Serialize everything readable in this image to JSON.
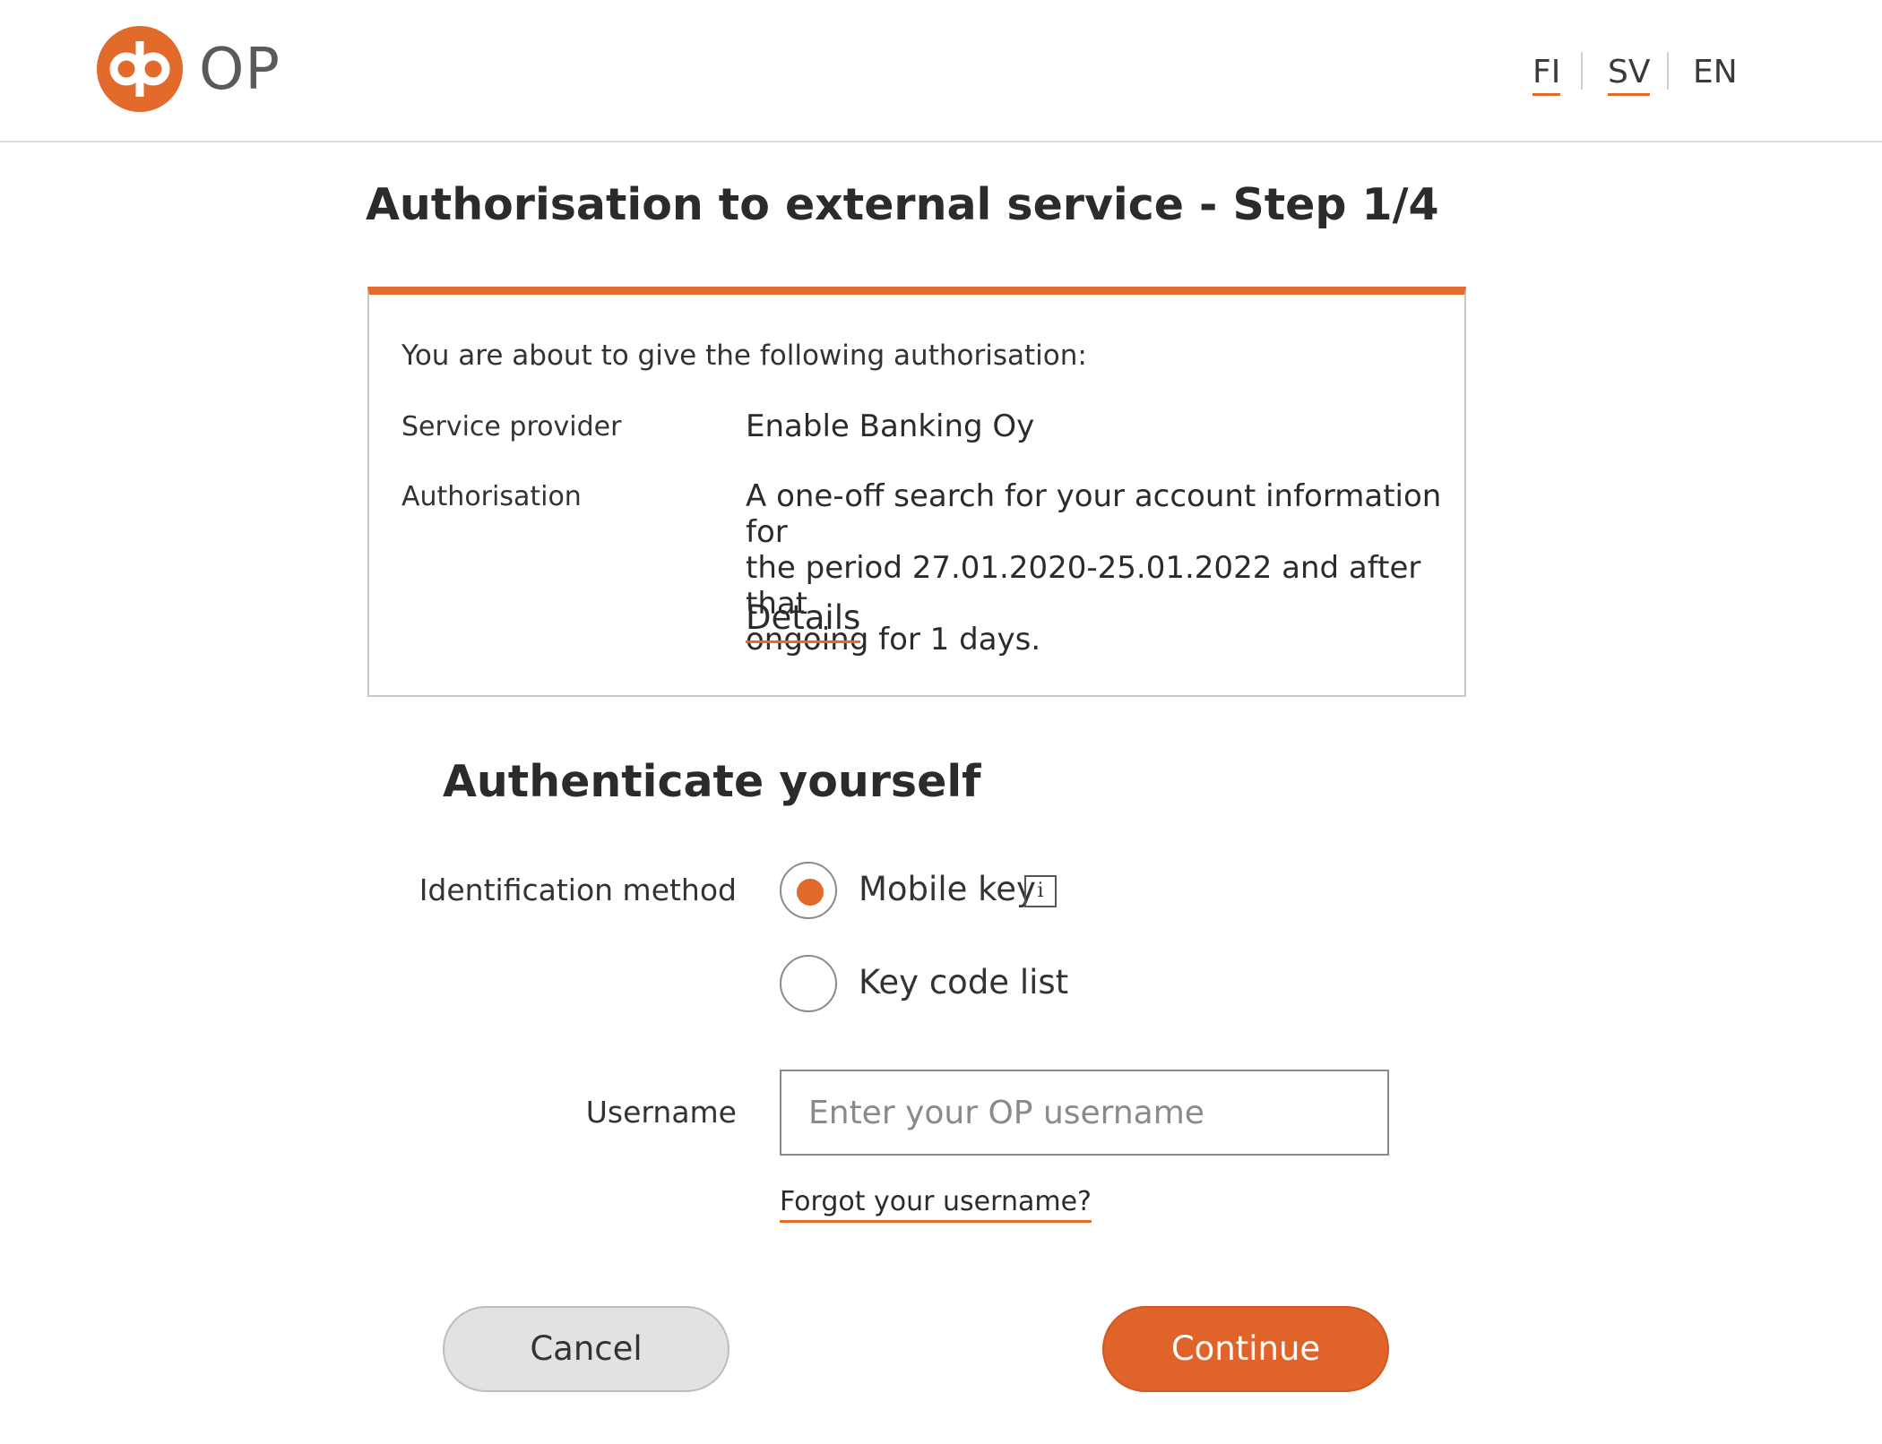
{
  "header": {
    "logo_text": "OP",
    "languages": [
      {
        "code": "FI",
        "linked": true
      },
      {
        "code": "SV",
        "linked": true
      },
      {
        "code": "EN",
        "linked": false
      }
    ]
  },
  "page": {
    "title": "Authorisation to external service - Step 1/4"
  },
  "authorisation": {
    "intro": "You are about to give the following authorisation:",
    "service_provider_label": "Service provider",
    "service_provider_value": "Enable Banking Oy",
    "authorisation_label": "Authorisation",
    "authorisation_lines": [
      "A one-off search for your account information for",
      "the period 27.01.2020-25.01.2022 and after that",
      "ongoing for 1 days."
    ],
    "details_link": "Details"
  },
  "authenticate": {
    "title": "Authenticate yourself",
    "identification_label": "Identification method",
    "methods": [
      {
        "label": "Mobile key",
        "selected": true,
        "info_icon": "info-icon"
      },
      {
        "label": "Key code list",
        "selected": false
      }
    ],
    "username_label": "Username",
    "username_placeholder": "Enter your OP username",
    "username_value": "",
    "forgot_link": "Forgot your username?"
  },
  "actions": {
    "cancel_label": "Cancel",
    "continue_label": "Continue"
  },
  "colors": {
    "accent": "#e26b2b",
    "continue_button": "#e0642a",
    "cancel_button": "#e2e2e2"
  }
}
